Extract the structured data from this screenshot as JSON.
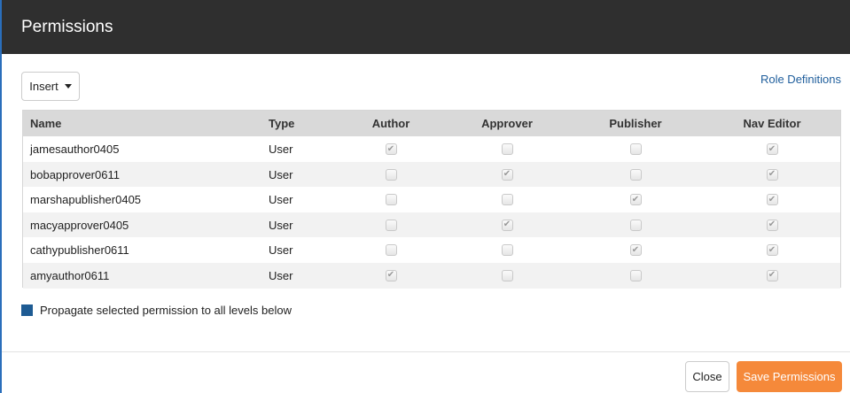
{
  "dialog": {
    "title": "Permissions"
  },
  "toolbar": {
    "insert_label": "Insert",
    "role_definitions_label": "Role Definitions"
  },
  "table": {
    "columns": [
      "Name",
      "Type",
      "Author",
      "Approver",
      "Publisher",
      "Nav Editor"
    ],
    "rows": [
      {
        "name": "jamesauthor0405",
        "type": "User",
        "author": true,
        "approver": false,
        "publisher": false,
        "nav_editor": true
      },
      {
        "name": "bobapprover0611",
        "type": "User",
        "author": false,
        "approver": true,
        "publisher": false,
        "nav_editor": true
      },
      {
        "name": "marshapublisher0405",
        "type": "User",
        "author": false,
        "approver": false,
        "publisher": true,
        "nav_editor": true
      },
      {
        "name": "macyapprover0405",
        "type": "User",
        "author": false,
        "approver": true,
        "publisher": false,
        "nav_editor": true
      },
      {
        "name": "cathypublisher0611",
        "type": "User",
        "author": false,
        "approver": false,
        "publisher": true,
        "nav_editor": true
      },
      {
        "name": "amyauthor0611",
        "type": "User",
        "author": true,
        "approver": false,
        "publisher": false,
        "nav_editor": true
      }
    ]
  },
  "propagate": {
    "label": "Propagate selected permission to all levels below",
    "checked": true
  },
  "footer": {
    "close_label": "Close",
    "save_label": "Save Permissions"
  },
  "colors": {
    "header_bg": "#2f2f2f",
    "accent_link": "#1f5e9c",
    "save_button": "#f5893a",
    "propagate_checkbox": "#1e5b93"
  }
}
